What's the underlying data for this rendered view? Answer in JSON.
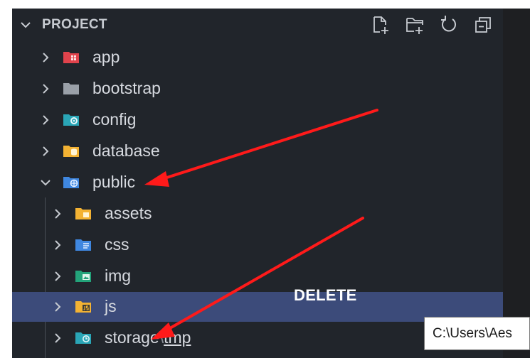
{
  "sidebar": {
    "title": "PROJECT",
    "header_actions": [
      {
        "name": "new-file",
        "icon": "new-file-icon"
      },
      {
        "name": "new-folder",
        "icon": "new-folder-icon"
      },
      {
        "name": "refresh",
        "icon": "refresh-icon"
      },
      {
        "name": "collapse-all",
        "icon": "collapse-all-icon"
      }
    ]
  },
  "tree": [
    {
      "label": "app",
      "expanded": false,
      "depth": 0,
      "icon": "folder-app-icon",
      "color": "#e0434c"
    },
    {
      "label": "bootstrap",
      "expanded": false,
      "depth": 0,
      "icon": "folder-icon",
      "color": "#9aa0a8"
    },
    {
      "label": "config",
      "expanded": false,
      "depth": 0,
      "icon": "folder-config-icon",
      "color": "#2aa6b7"
    },
    {
      "label": "database",
      "expanded": false,
      "depth": 0,
      "icon": "folder-database-icon",
      "color": "#f3b233"
    },
    {
      "label": "public",
      "expanded": true,
      "depth": 0,
      "icon": "folder-public-icon",
      "color": "#3f87e0"
    },
    {
      "label": "assets",
      "expanded": false,
      "depth": 1,
      "icon": "folder-assets-icon",
      "color": "#f3b233"
    },
    {
      "label": "css",
      "expanded": false,
      "depth": 1,
      "icon": "folder-css-icon",
      "color": "#3f87e0"
    },
    {
      "label": "img",
      "expanded": false,
      "depth": 1,
      "icon": "folder-images-icon",
      "color": "#23a37a"
    },
    {
      "label": "js",
      "expanded": false,
      "depth": 1,
      "icon": "folder-js-icon",
      "color": "#f3b233",
      "selected": true
    },
    {
      "label": "storage",
      "separator": "\\",
      "sublabel": "tmp",
      "expanded": false,
      "depth": 1,
      "icon": "folder-temp-icon",
      "color": "#2aa6b7"
    }
  ],
  "annotation": {
    "text": "DELETE",
    "color": "#ff1a1a"
  },
  "tooltip": {
    "text": "C:\\Users\\Aes"
  },
  "colors": {
    "sidebar_bg": "#21252b",
    "selection_bg": "#3c4b7a",
    "text": "#d7dae0"
  }
}
